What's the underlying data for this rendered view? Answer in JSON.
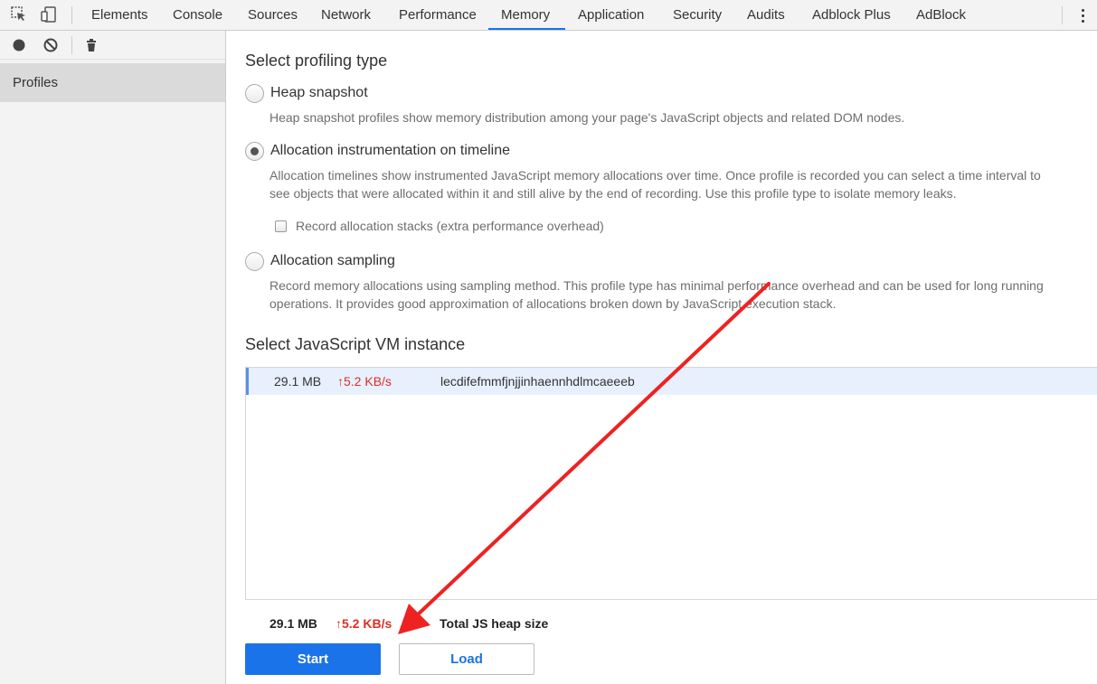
{
  "tabs": [
    "Elements",
    "Console",
    "Sources",
    "Network",
    "Performance",
    "Memory",
    "Application",
    "Security",
    "Audits",
    "Adblock Plus",
    "AdBlock"
  ],
  "active_tab": "Memory",
  "sidebar": {
    "item": "Profiles"
  },
  "profiling": {
    "title": "Select profiling type",
    "options": [
      {
        "label": "Heap snapshot",
        "desc": [
          "Heap snapshot profiles show memory distribution among your page's JavaScript objects and related DOM nodes."
        ],
        "checked": false
      },
      {
        "label": "Allocation instrumentation on timeline",
        "desc": [
          "Allocation timelines show instrumented JavaScript memory allocations over time. Once profile is recorded you can select a time interval to",
          "see objects that were allocated within it and still alive by the end of recording. Use this profile type to isolate memory leaks."
        ],
        "checked": true
      },
      {
        "label": "Allocation sampling",
        "desc": [
          "Record memory allocations using sampling method. This profile type has minimal performance overhead and can be used for long running",
          "operations. It provides good approximation of allocations broken down by JavaScript execution stack."
        ],
        "checked": false
      }
    ],
    "checkbox_label": "Record allocation stacks (extra performance overhead)"
  },
  "vm": {
    "title": "Select JavaScript VM instance",
    "row": {
      "size": "29.1 MB",
      "rate": "↑5.2 KB/s",
      "name": "lecdifefmmfjnjjinhaennhdlmcaeeeb"
    }
  },
  "summary": {
    "size": "29.1 MB",
    "rate": "↑5.2 KB/s",
    "label": "Total JS heap size"
  },
  "buttons": {
    "start": "Start",
    "load": "Load"
  },
  "colors": {
    "accent": "#1a73e8",
    "rate_red": "#d93025",
    "annotation_arrow": "#ee2222"
  }
}
